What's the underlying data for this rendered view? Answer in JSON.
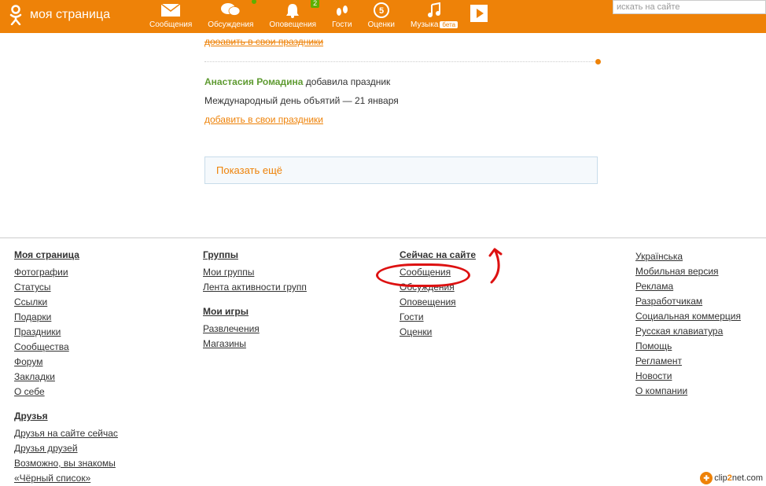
{
  "header": {
    "title": "моя страница",
    "nav": [
      {
        "label": "Сообщения",
        "icon": "mail"
      },
      {
        "label": "Обсуждения",
        "icon": "chat",
        "badge": ""
      },
      {
        "label": "Оповещения",
        "icon": "bell",
        "badge": "2"
      },
      {
        "label": "Гости",
        "icon": "feet"
      },
      {
        "label": "Оценки",
        "icon": "five"
      },
      {
        "label": "Музыка",
        "icon": "music",
        "beta": "бета"
      }
    ],
    "search_placeholder": "искать на сайте"
  },
  "feed": {
    "add_link_top": "дооавить в свои праздники",
    "user": "Анастасия Ромадина",
    "action": " добавила праздник",
    "text": "Международный день объятий — 21 января",
    "add_link": "добавить в свои праздники",
    "show_more": "Показать ещё"
  },
  "footer": {
    "col1": {
      "header": "Моя страница",
      "links": [
        "Фотографии",
        "Статусы",
        "Ссылки",
        "Подарки",
        "Праздники",
        "Сообщества",
        "Форум",
        "Закладки",
        "О себе"
      ],
      "header2": "Друзья",
      "links2": [
        "Друзья на сайте сейчас",
        "Друзья друзей",
        "Возможно, вы знакомы",
        "«Чёрный список»"
      ]
    },
    "col2": {
      "header": "Группы",
      "links": [
        "Мои группы",
        "Лента активности групп"
      ],
      "header2": "Мои игры",
      "links2": [
        "Развлечения",
        "Магазины"
      ]
    },
    "col3": {
      "header": "Сейчас на сайте",
      "links": [
        "Сообщения",
        "Обсуждения",
        "Оповещения",
        "Гости",
        "Оценки"
      ]
    },
    "col4": {
      "links": [
        "Українська",
        "Мобильная версия",
        "Реклама",
        "Разработчикам",
        "Социальная коммерция",
        "Русская клавиатура",
        "Помощь",
        "Регламент",
        "Новости",
        "О компании"
      ]
    }
  },
  "watermark": {
    "p1": "clip",
    "p2": "2",
    "p3": "net.com"
  }
}
